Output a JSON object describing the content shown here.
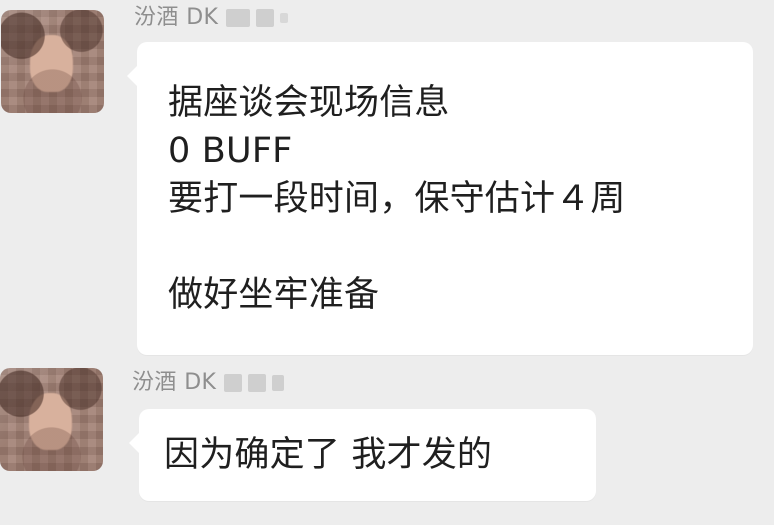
{
  "messages": [
    {
      "sender_name": "汾酒 DK",
      "text": "据座谈会现场信息\n0 BUFF\n要打一段时间，保守估计４周\n\n做好坐牢准备"
    },
    {
      "sender_name": "汾酒 DK",
      "text": "因为确定了 我才发的"
    }
  ]
}
